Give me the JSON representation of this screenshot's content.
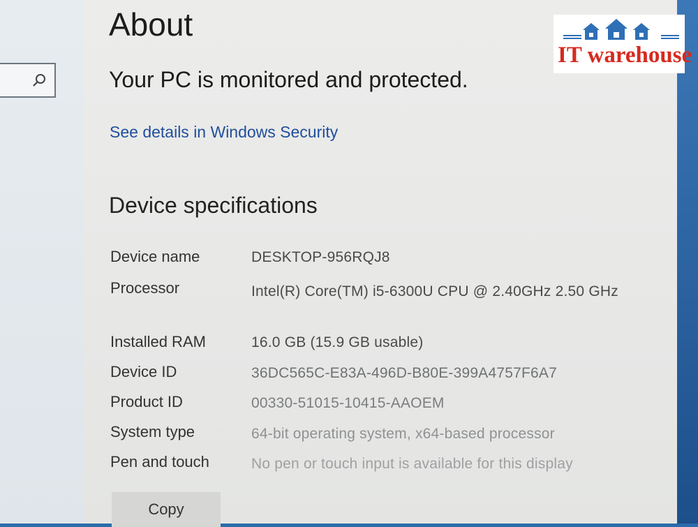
{
  "search": {
    "icon": "search-icon"
  },
  "page": {
    "title": "About",
    "status_heading": "Your PC is monitored and protected.",
    "security_link": "See details in Windows Security",
    "section_heading": "Device specifications"
  },
  "specs": [
    {
      "label": "Device name",
      "value": "DESKTOP-956RQJ8"
    },
    {
      "label": "Processor",
      "value": "Intel(R) Core(TM) i5-6300U CPU @ 2.40GHz   2.50 GHz"
    },
    {
      "label": "Installed RAM",
      "value": "16.0 GB (15.9 GB usable)"
    },
    {
      "label": "Device ID",
      "value": "36DC565C-E83A-496D-B80E-399A4757F6A7"
    },
    {
      "label": "Product ID",
      "value": "00330-51015-10415-AAOEM"
    },
    {
      "label": "System type",
      "value": "64-bit operating system, x64-based processor"
    },
    {
      "label": "Pen and touch",
      "value": "No pen or touch input is available for this display"
    }
  ],
  "copy_button": "Copy",
  "logo": {
    "prefix": "IT",
    "name": "warehouse",
    "colors": {
      "text": "#d62a1f",
      "houses": "#2f6fb5"
    }
  }
}
